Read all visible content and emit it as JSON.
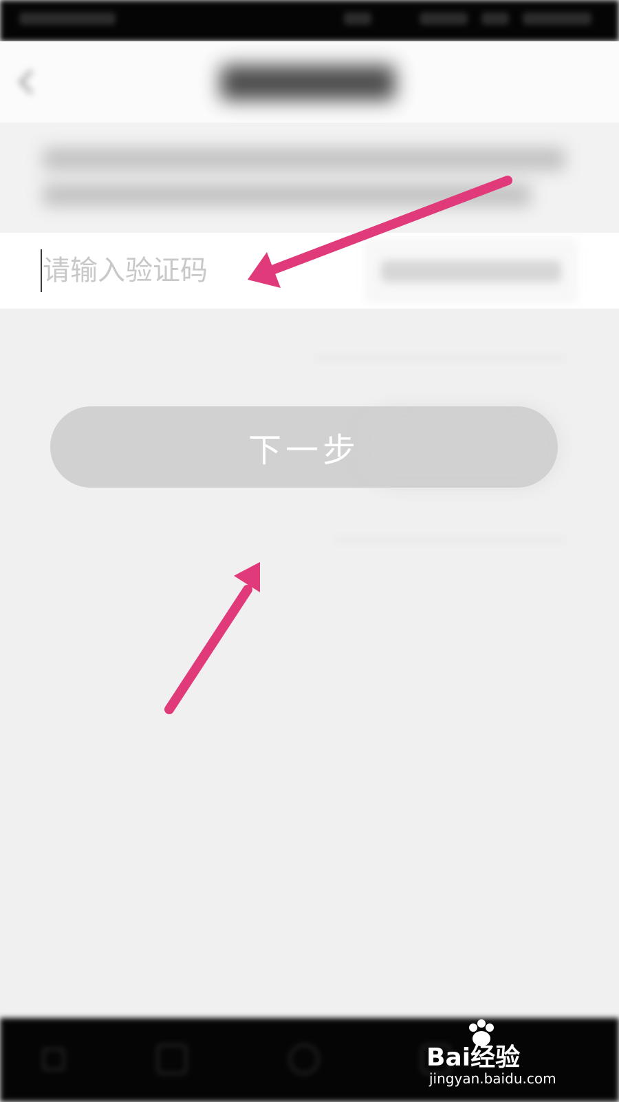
{
  "verify": {
    "code_input": {
      "placeholder": "请输入验证码",
      "value": ""
    }
  },
  "actions": {
    "next_label": "下一步"
  },
  "annotation": {
    "arrow_color": "#e03a7b"
  },
  "watermark": {
    "brand": "Bai经验",
    "url": "jingyan.baidu.com"
  },
  "colors": {
    "background": "#f0f0f0",
    "button": "#d1d1d1",
    "status_bar": "#050505"
  }
}
